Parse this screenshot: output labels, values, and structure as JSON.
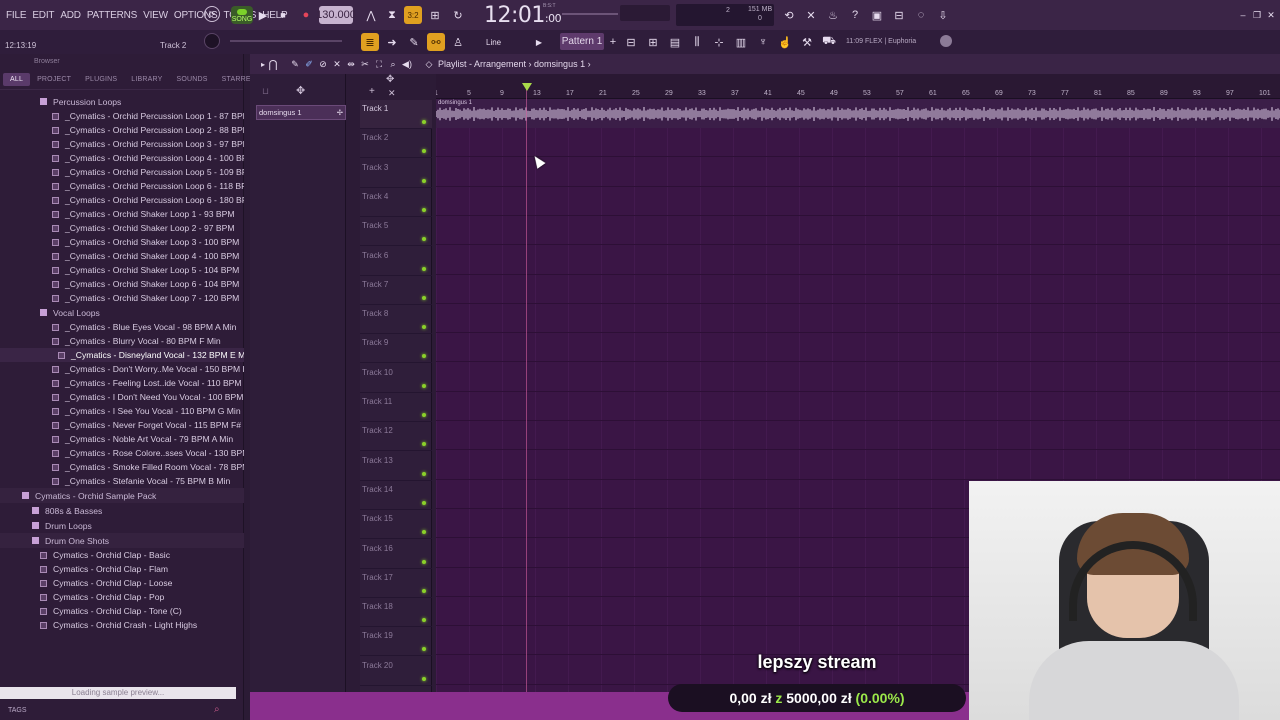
{
  "menu": [
    "FILE",
    "EDIT",
    "ADD",
    "PATTERNS",
    "VIEW",
    "OPTIONS",
    "TOOLS",
    "HELP"
  ],
  "transport": {
    "song_label": "SONG",
    "bpm": "130.000",
    "time_main": "12:01",
    "time_sub": ":00",
    "time_caption": "B:S:T",
    "meter_cpu": "2",
    "meter_mem": "151 MB",
    "meter_poly": "0"
  },
  "row2": {
    "clock": "12:13:19",
    "track_hint": "Track 2",
    "snap": "Line",
    "pattern": "Pattern 1",
    "hint": "11:09 FLEX | Euphoria"
  },
  "browser": {
    "title": "Browser",
    "tabs": [
      "ALL",
      "PROJECT",
      "PLUGINS",
      "LIBRARY",
      "SOUNDS",
      "STARRED"
    ],
    "items": [
      {
        "label": "Percussion Loops",
        "type": "folder",
        "indent": 40
      },
      {
        "label": "_Cymatics - Orchid Percussion Loop 1 - 87 BPM",
        "type": "file",
        "indent": 52
      },
      {
        "label": "_Cymatics - Orchid Percussion Loop 2 - 88 BPM",
        "type": "file",
        "indent": 52
      },
      {
        "label": "_Cymatics - Orchid Percussion Loop 3 - 97 BPM",
        "type": "file",
        "indent": 52
      },
      {
        "label": "_Cymatics - Orchid Percussion Loop 4 - 100 BPM",
        "type": "file",
        "indent": 52
      },
      {
        "label": "_Cymatics - Orchid Percussion Loop 5 - 109 BPM",
        "type": "file",
        "indent": 52
      },
      {
        "label": "_Cymatics - Orchid Percussion Loop 6 - 118 BPM",
        "type": "file",
        "indent": 52
      },
      {
        "label": "_Cymatics - Orchid Percussion Loop 6 - 180 BPM",
        "type": "file",
        "indent": 52
      },
      {
        "label": "_Cymatics - Orchid Shaker Loop 1 - 93 BPM",
        "type": "file",
        "indent": 52
      },
      {
        "label": "_Cymatics - Orchid Shaker Loop 2 - 97 BPM",
        "type": "file",
        "indent": 52
      },
      {
        "label": "_Cymatics - Orchid Shaker Loop 3 - 100 BPM",
        "type": "file",
        "indent": 52
      },
      {
        "label": "_Cymatics - Orchid Shaker Loop 4 - 100 BPM",
        "type": "file",
        "indent": 52
      },
      {
        "label": "_Cymatics - Orchid Shaker Loop 5 - 104 BPM",
        "type": "file",
        "indent": 52
      },
      {
        "label": "_Cymatics - Orchid Shaker Loop 6 - 104 BPM",
        "type": "file",
        "indent": 52
      },
      {
        "label": "_Cymatics - Orchid Shaker Loop 7 - 120 BPM",
        "type": "file",
        "indent": 52
      },
      {
        "label": "Vocal Loops",
        "type": "folder",
        "indent": 40
      },
      {
        "label": "_Cymatics - Blue Eyes Vocal - 98 BPM A Min",
        "type": "file",
        "indent": 52
      },
      {
        "label": "_Cymatics - Blurry Vocal - 80 BPM F Min",
        "type": "file",
        "indent": 52
      },
      {
        "label": "_Cymatics - Disneyland Vocal - 132 BPM E Min",
        "type": "file",
        "indent": 58,
        "selected": true
      },
      {
        "label": "_Cymatics - Don't Worry..Me Vocal - 150 BPM E Maj",
        "type": "file",
        "indent": 52
      },
      {
        "label": "_Cymatics - Feeling Lost..ide Vocal - 110 BPM F# Min",
        "type": "file",
        "indent": 52
      },
      {
        "label": "_Cymatics - I Don't Need You Vocal - 100 BPM G Min",
        "type": "file",
        "indent": 52
      },
      {
        "label": "_Cymatics - I See You Vocal - 110 BPM G Min",
        "type": "file",
        "indent": 52
      },
      {
        "label": "_Cymatics - Never Forget Vocal - 115 BPM F# Min",
        "type": "file",
        "indent": 52
      },
      {
        "label": "_Cymatics - Noble Art Vocal - 79 BPM A Min",
        "type": "file",
        "indent": 52
      },
      {
        "label": "_Cymatics - Rose Colore..sses Vocal - 130 BPM B Min",
        "type": "file",
        "indent": 52
      },
      {
        "label": "_Cymatics - Smoke Filled Room Vocal - 78 BPM D Maj",
        "type": "file",
        "indent": 52
      },
      {
        "label": "_Cymatics - Stefanie Vocal - 75 BPM B Min",
        "type": "file",
        "indent": 52
      },
      {
        "label": "Cymatics - Orchid Sample Pack",
        "type": "folder",
        "indent": 22,
        "group": true
      },
      {
        "label": "808s & Basses",
        "type": "folder",
        "indent": 32
      },
      {
        "label": "Drum Loops",
        "type": "folder",
        "indent": 32
      },
      {
        "label": "Drum One Shots",
        "type": "folder",
        "indent": 32,
        "group": true
      },
      {
        "label": "Cymatics - Orchid Clap - Basic",
        "type": "file",
        "indent": 40
      },
      {
        "label": "Cymatics - Orchid Clap - Flam",
        "type": "file",
        "indent": 40
      },
      {
        "label": "Cymatics - Orchid Clap - Loose",
        "type": "file",
        "indent": 40
      },
      {
        "label": "Cymatics - Orchid Clap - Pop",
        "type": "file",
        "indent": 40
      },
      {
        "label": "Cymatics - Orchid Clap - Tone (C)",
        "type": "file",
        "indent": 40
      },
      {
        "label": "Cymatics - Orchid Crash - Light Highs",
        "type": "file",
        "indent": 40
      }
    ],
    "status": "Loading sample preview...",
    "tags_label": "TAGS"
  },
  "playlist": {
    "title": "Playlist - Arrangement",
    "subtitle": "domsingus 1",
    "picker_item": "domsingus 1",
    "clip_label": "domsingus 1",
    "tracks": [
      "Track 1",
      "Track 2",
      "Track 3",
      "Track 4",
      "Track 5",
      "Track 6",
      "Track 7",
      "Track 8",
      "Track 9",
      "Track 10",
      "Track 11",
      "Track 12",
      "Track 13",
      "Track 14",
      "Track 15",
      "Track 16",
      "Track 17",
      "Track 18",
      "Track 19",
      "Track 20"
    ],
    "ruler": [
      "1",
      "5",
      "9",
      "13",
      "17",
      "21",
      "25",
      "29",
      "33",
      "37",
      "41",
      "45",
      "49",
      "53",
      "57",
      "61",
      "65",
      "69",
      "73",
      "77",
      "81",
      "85",
      "89",
      "93",
      "97",
      "101"
    ]
  },
  "overlay": {
    "stream_title": "lepszy stream",
    "donation_amount": "0,00 zł",
    "donation_sep": "z",
    "donation_goal": "5000,00 zł",
    "donation_pct": "(0.00%)"
  },
  "colors": {
    "accent": "#8bd12a",
    "grid_bg": "#3a1545",
    "pct": "#9be84a"
  }
}
